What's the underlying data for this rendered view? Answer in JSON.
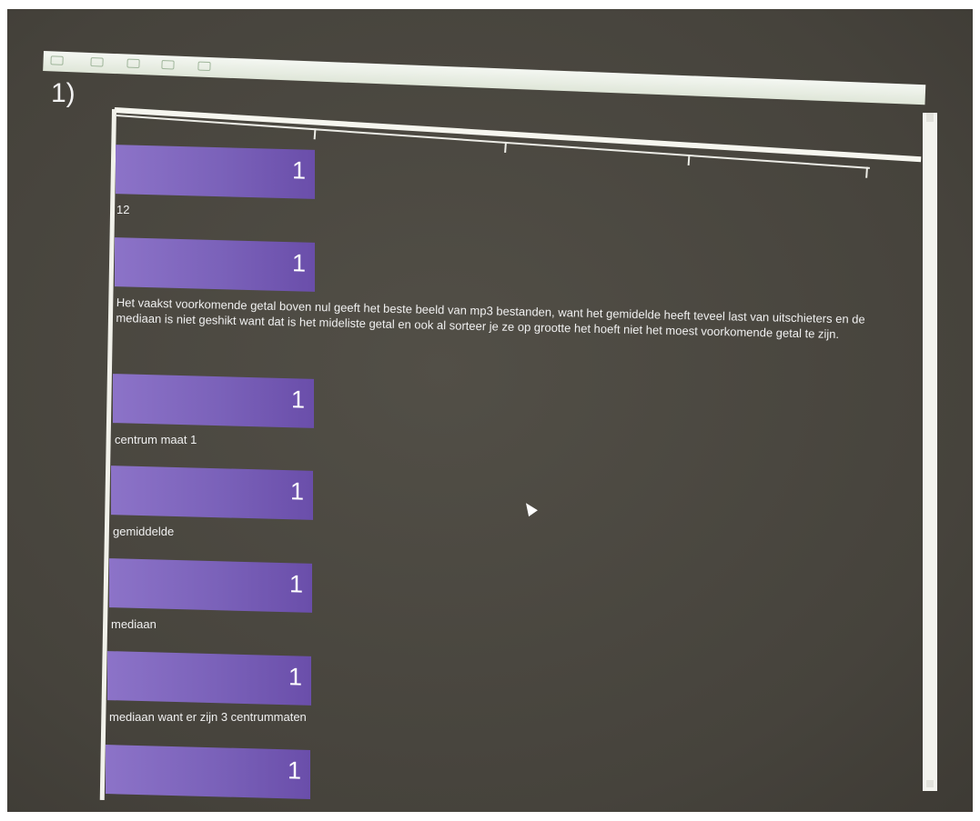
{
  "question_number": "1)",
  "answers": [
    {
      "count": "1",
      "text": "12"
    },
    {
      "count": "1",
      "text": "Het vaakst voorkomende getal boven nul geeft het beste beeld van mp3 bestanden, want het gemidelde heeft teveel last van uitschieters en de mediaan is niet geshikt want dat is het mideliste getal en ook al sorteer je ze op grootte het hoeft niet het moest voorkomende getal te zijn."
    },
    {
      "count": "1",
      "text": "centrum maat 1"
    },
    {
      "count": "1",
      "text": "gemiddelde"
    },
    {
      "count": "1",
      "text": "mediaan"
    },
    {
      "count": "1",
      "text": "mediaan want er zijn 3 centrummaten"
    },
    {
      "count": "1",
      "text": ""
    }
  ],
  "colors": {
    "background": "#4a473f",
    "bar": "#7a61b9",
    "text": "#f0f0f0"
  }
}
